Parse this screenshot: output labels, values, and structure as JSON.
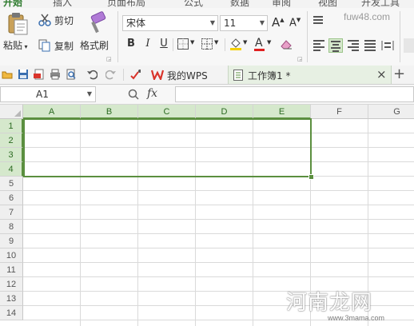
{
  "menu": {
    "tabs": [
      "开始",
      "插入",
      "页面布局",
      "公式",
      "数据",
      "审阅",
      "视图",
      "开发工具"
    ]
  },
  "ribbon": {
    "paste_label": "粘贴",
    "cut_label": "剪切",
    "copy_label": "复制",
    "format_painter_label": "格式刷",
    "font_name": "宋体",
    "font_size": "11",
    "bold": "B",
    "italic": "I",
    "underline": "U",
    "grow_font": "A",
    "shrink_font": "A"
  },
  "quick_access": {
    "wps_tab_label": "我的WPS",
    "doc_tab_label": "工作簿1 *",
    "close_glyph": "×",
    "new_tab_glyph": "+"
  },
  "formula_bar": {
    "name_box": "A1",
    "fx_label": "fx"
  },
  "sheet": {
    "columns": [
      "A",
      "B",
      "C",
      "D",
      "E",
      "F",
      "G"
    ],
    "rows": [
      "1",
      "2",
      "3",
      "4",
      "5",
      "6",
      "7",
      "8",
      "9",
      "10",
      "11",
      "12",
      "13",
      "14"
    ],
    "selection": "A1:E4"
  },
  "watermark": {
    "main": "河南龙网",
    "sub": "www.3mama.com",
    "top": "fuw48.com"
  },
  "colors": {
    "accent": "#5b8f3f",
    "selected_header": "#d5e8cc",
    "wps_red": "#d9342b"
  }
}
